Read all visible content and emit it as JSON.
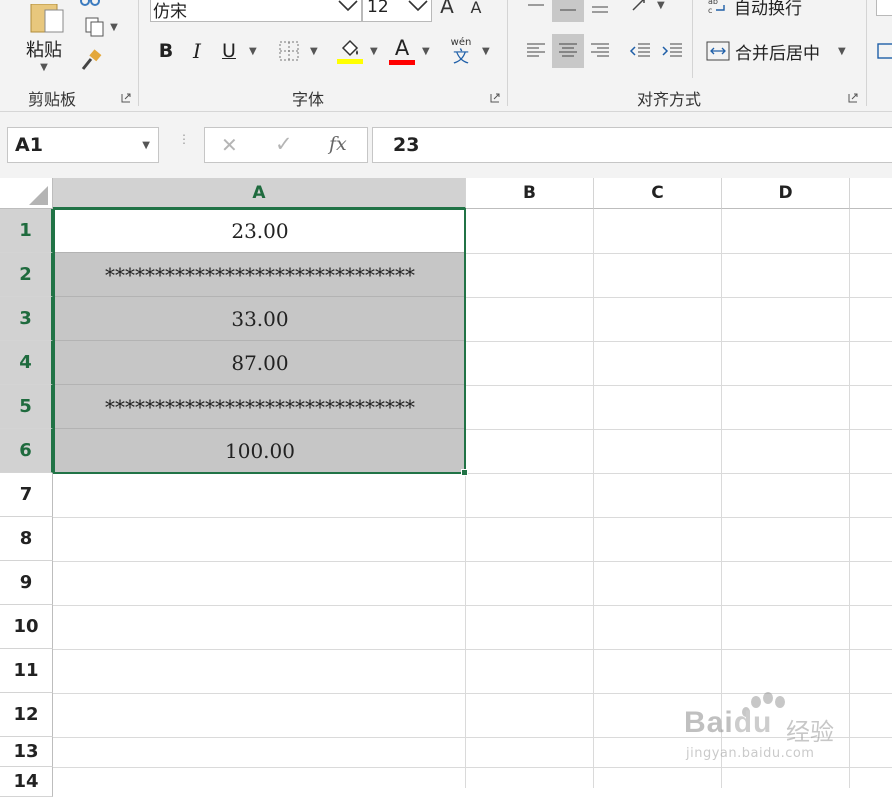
{
  "ribbon": {
    "clipboard": {
      "paste_label": "粘贴",
      "group_label": "剪贴板"
    },
    "font": {
      "font_name": "仿宋",
      "font_size": "12",
      "bold": "B",
      "italic": "I",
      "underline": "U",
      "font_color_letter": "A",
      "phonetic_top": "wén",
      "phonetic_bottom": "文",
      "group_label": "字体",
      "fill_color": "#ffff00",
      "font_color": "#ff0000"
    },
    "alignment": {
      "wrap_text": "自动换行",
      "merge_center": "合并后居中",
      "group_label": "对齐方式"
    }
  },
  "formula_bar": {
    "name_box": "A1",
    "cancel": "✕",
    "enter": "✓",
    "fx": "fx",
    "content": "23"
  },
  "sheet": {
    "columns": [
      "A",
      "B",
      "C",
      "D"
    ],
    "rows": [
      "1",
      "2",
      "3",
      "4",
      "5",
      "6",
      "7",
      "8",
      "9",
      "10",
      "11",
      "12",
      "13",
      "14"
    ],
    "cells_a": [
      "23.00",
      "*******************************",
      "33.00",
      "87.00",
      "*******************************",
      "100.00"
    ],
    "selection": "A1:A6",
    "accent_color": "#217346"
  },
  "watermark": {
    "brand": "Bai",
    "brand_paw": "du",
    "cn": "经验",
    "url": "jingyan.baidu.com"
  }
}
